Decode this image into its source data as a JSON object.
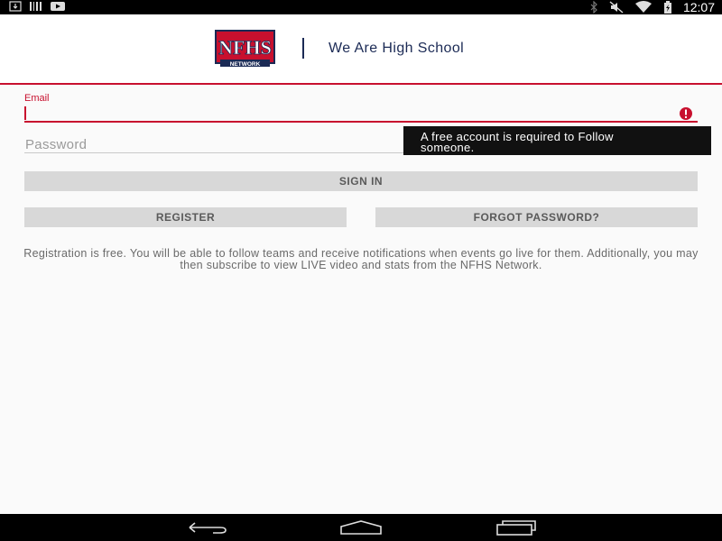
{
  "status_bar": {
    "time": "12:07",
    "left_icons": [
      "download-icon",
      "barcode-icon",
      "youtube-icon"
    ],
    "right_icons": [
      "bluetooth-icon",
      "mute-icon",
      "wifi-icon",
      "battery-icon"
    ]
  },
  "header": {
    "logo_text": "NFHS",
    "logo_subtext": "NETWORK",
    "tagline": "We Are High School"
  },
  "form": {
    "email_label": "Email",
    "email_value": "",
    "password_placeholder": "Password",
    "error_message": "A free account is required to Follow someone.",
    "error_line1": "A free account is required to Follow",
    "error_line2": "someone.",
    "sign_in_label": "SIGN IN",
    "register_label": "REGISTER",
    "forgot_password_label": "FORGOT PASSWORD?"
  },
  "info_text": "Registration is free. You will be able to follow teams and receive notifications when events go live for them. Additionally, you may then subscribe to view LIVE video and stats from the NFHS Network.",
  "colors": {
    "accent": "#c8102e",
    "navy": "#1b2a55",
    "button_bg": "#d8d8d8"
  },
  "nav_bar": {
    "buttons": [
      "back-icon",
      "home-icon",
      "recents-icon"
    ]
  }
}
